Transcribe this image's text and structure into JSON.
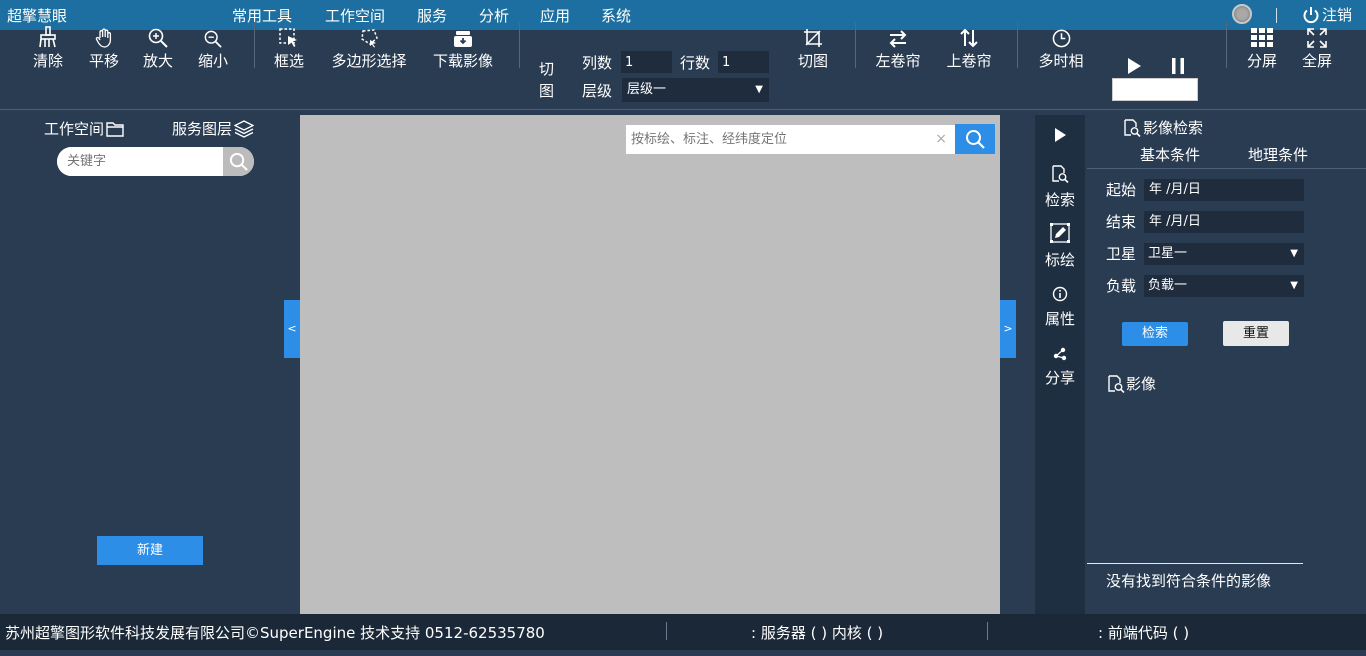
{
  "app": {
    "title": "超擎慧眼"
  },
  "menu": [
    "常用工具",
    "工作空间",
    "服务",
    "分析",
    "应用",
    "系统"
  ],
  "header": {
    "logout": "注销"
  },
  "toolbar": {
    "clear": "清除",
    "pan": "平移",
    "zoom_in": "放大",
    "zoom_out": "缩小",
    "box_select": "框选",
    "polygon_select": "多边形选择",
    "download_image": "下载影像",
    "cut_col1": "切",
    "cut_col2": "图",
    "cols_label": "列数",
    "cols_value": "1",
    "rows_label": "行数",
    "rows_value": "1",
    "level_label": "层级",
    "level_value": "层级一",
    "crop": "切图",
    "left_swipe": "左卷帘",
    "up_swipe": "上卷帘",
    "multi_temporal": "多时相",
    "split_screen": "分屏",
    "fullscreen": "全屏"
  },
  "left_panel": {
    "tab_workspace": "工作空间",
    "tab_service_layers": "服务图层",
    "search_placeholder": "关键字",
    "new_button": "新建"
  },
  "map": {
    "search_placeholder": "按标绘、标注、经纬度定位",
    "clear_symbol": "×",
    "collapse_left": "<",
    "collapse_right": ">"
  },
  "right_strip": {
    "search": "检索",
    "draw": "标绘",
    "properties": "属性",
    "share": "分享"
  },
  "right_panel": {
    "title": "影像检索",
    "tab_basic": "基本条件",
    "tab_geo": "地理条件",
    "start_label": "起始",
    "start_value": "年 /月/日",
    "end_label": "结束",
    "end_value": "年 /月/日",
    "satellite_label": "卫星",
    "satellite_value": "卫星一",
    "payload_label": "负载",
    "payload_value": "负载一",
    "search_button": "检索",
    "reset_button": "重置",
    "image_heading": "影像",
    "no_result": "没有找到符合条件的影像"
  },
  "footer": {
    "copyright": "苏州超擎图形软件科技发展有限公司©SuperEngine 技术支持 0512-62535780",
    "server_kernel": ": 服务器 ( ) 内核 ( )",
    "frontend_code": ": 前端代码 ( )"
  },
  "colors": {
    "topbar": "#1c6fa0",
    "background": "#2a3c52",
    "accent": "#2d8ee8",
    "map": "#bebebe"
  }
}
